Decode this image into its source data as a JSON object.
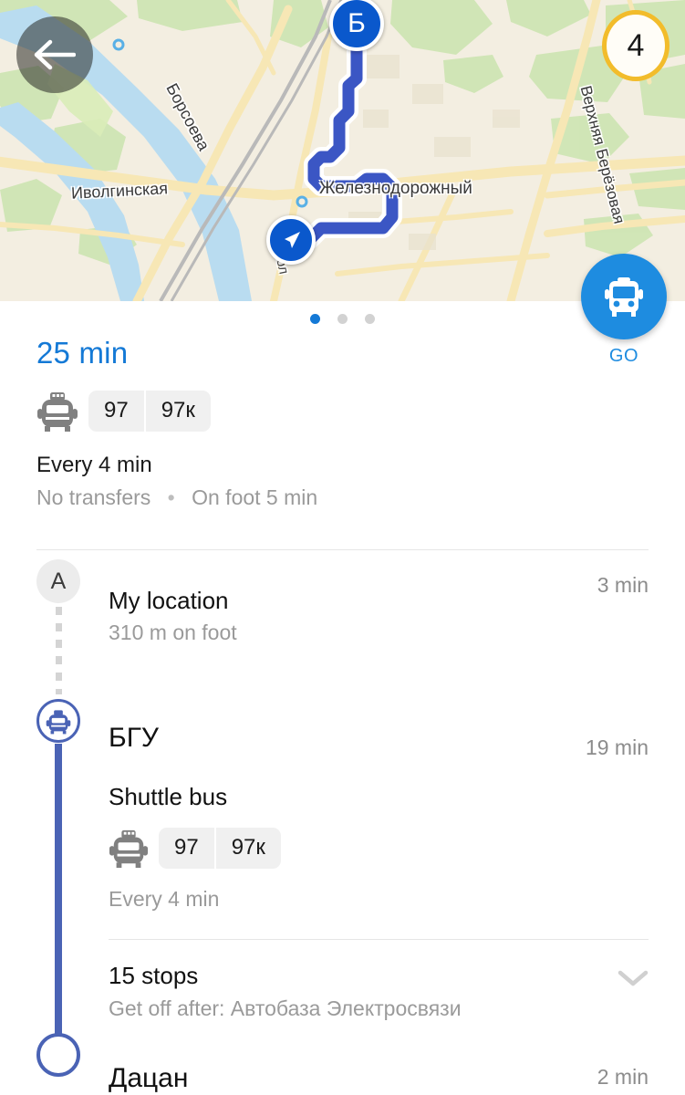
{
  "map": {
    "back_icon": "arrow-left-icon",
    "traffic_badge": "4",
    "destination_marker_label": "Б",
    "my_position_icon": "navigation-arrow-icon",
    "labels": [
      {
        "id": "zhd",
        "text": "Железнодорожный"
      },
      {
        "id": "ivolginskaya",
        "text": "Иволгинская"
      },
      {
        "id": "borsoeva",
        "text": "Борсоева"
      },
      {
        "id": "verkhnyaya",
        "text": "Верхняя Берёзовая"
      },
      {
        "id": "molodezhnaya",
        "text": "мол"
      }
    ],
    "go_button": {
      "label": "GO",
      "icon": "bus-icon"
    }
  },
  "pager": {
    "count": 3,
    "active_index": 0
  },
  "summary": {
    "eta": "25 min",
    "transport_icon": "minibus-icon",
    "route_numbers": [
      "97",
      "97к"
    ],
    "frequency": "Every 4 min",
    "transfers": "No transfers",
    "separator": "•",
    "on_foot": "On foot 5 min"
  },
  "itinerary": {
    "start": {
      "badge": "A",
      "title": "My location",
      "subtitle": "310 m on foot",
      "time": "3 min"
    },
    "board": {
      "icon": "minibus-stop-icon",
      "title": "БГУ",
      "time": "19 min"
    },
    "leg": {
      "mode": "Shuttle bus",
      "transport_icon": "minibus-icon",
      "route_numbers": [
        "97",
        "97к"
      ],
      "frequency": "Every 4 min"
    },
    "stops": {
      "count_label": "15 stops",
      "get_off": "Get off after: Автобаза Электросвязи",
      "expand_icon": "chevron-down-icon"
    },
    "end": {
      "title": "Дацан",
      "time": "2 min"
    }
  },
  "colors": {
    "accent_blue": "#1479d6",
    "go_blue": "#1e8ce0",
    "route_line": "#4a63b5",
    "marker_blue": "#0a58cc",
    "badge_ring": "#f2bc2b",
    "muted_text": "#9a9a9a"
  }
}
